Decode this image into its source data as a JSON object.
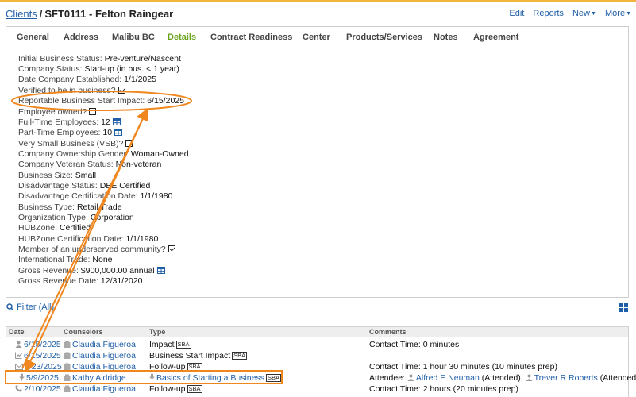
{
  "breadcrumb": {
    "parent": "Clients",
    "separator": "/",
    "title": "SFT0111 - Felton Raingear"
  },
  "header_actions": {
    "edit": "Edit",
    "reports": "Reports",
    "new": "New",
    "more": "More"
  },
  "tabs": [
    "General",
    "Address",
    "Malibu BC",
    "Details",
    "Contract Readiness",
    "Center",
    "Products/Services",
    "Notes",
    "Agreement"
  ],
  "active_tab": "Details",
  "details": [
    {
      "label": "Initial Business Status:",
      "value": "Pre-venture/Nascent"
    },
    {
      "label": "Company Status:",
      "value": "Start-up (in bus. < 1 year)"
    },
    {
      "label": "Date Company Established:",
      "value": "1/1/2025"
    },
    {
      "label": "Verified to be in business?",
      "value": ""
    },
    {
      "label": "Reportable Business Start Impact:",
      "value": "6/15/2025"
    },
    {
      "label": "Employee owned?",
      "value": ""
    },
    {
      "label": "Full-Time Employees:",
      "value": "12"
    },
    {
      "label": "Part-Time Employees:",
      "value": "10"
    },
    {
      "label": "Very Small Business (VSB)?",
      "value": ""
    },
    {
      "label": "Company Ownership Gender:",
      "value": "Woman-Owned"
    },
    {
      "label": "Company Veteran Status:",
      "value": "Non-veteran"
    },
    {
      "label": "Business Size:",
      "value": "Small"
    },
    {
      "label": "Disadvantage Status:",
      "value": "DBE Certified"
    },
    {
      "label": "Disadvantage Certification Date:",
      "value": "1/1/1980"
    },
    {
      "label": "Business Type:",
      "value": "Retail Trade"
    },
    {
      "label": "Organization Type:",
      "value": "Corporation"
    },
    {
      "label": "HUBZone:",
      "value": "Certified"
    },
    {
      "label": "HUBZone Certification Date:",
      "value": "1/1/1980"
    },
    {
      "label": "Member of an underserved community?",
      "value": ""
    },
    {
      "label": "International Trade:",
      "value": "None"
    },
    {
      "label": "Gross Revenue:",
      "value": "$900,000.00 annual"
    },
    {
      "label": "Gross Revenue Date:",
      "value": "12/31/2020"
    }
  ],
  "filter": {
    "label": "Filter (All)"
  },
  "table": {
    "columns": [
      "Date",
      "Counselors",
      "Type",
      "Comments"
    ],
    "badge": "SBA",
    "rows": [
      {
        "icon": "person-icon",
        "date": "6/15/2025",
        "counselor": "Claudia Figueroa",
        "type": "Impact",
        "type_link": false,
        "comments": "Contact Time:  0 minutes"
      },
      {
        "icon": "trend-icon",
        "date": "6/15/2025",
        "counselor": "Claudia Figueroa",
        "type": "Business Start Impact",
        "type_link": false,
        "comments": ""
      },
      {
        "icon": "envelope-icon",
        "date": "5/23/2025",
        "counselor": "Claudia Figueroa",
        "type": "Follow-up",
        "type_link": false,
        "comments": "Contact Time:  1 hour 30 minutes (10 minutes prep)"
      },
      {
        "icon": "microphone-icon",
        "date": "5/9/2025",
        "counselor": "Kathy Aldridge",
        "type": "Basics of Starting a Business",
        "type_link": true,
        "comments_label": "Attendee:",
        "attendees": [
          "Alfred E Neuman",
          "(Attended),",
          "Trever R Roberts",
          "(Attended)"
        ]
      },
      {
        "icon": "phone-icon",
        "date": "2/10/2025",
        "counselor": "Claudia Figueroa",
        "type": "Follow-up",
        "type_link": false,
        "comments": "Contact Time:  2 hours (20 minutes prep)"
      }
    ]
  },
  "colors": {
    "link": "#1f5fa8",
    "active_tab": "#6aa21a",
    "annotation": "#f0861e",
    "top_bar": "#f0b53a"
  }
}
